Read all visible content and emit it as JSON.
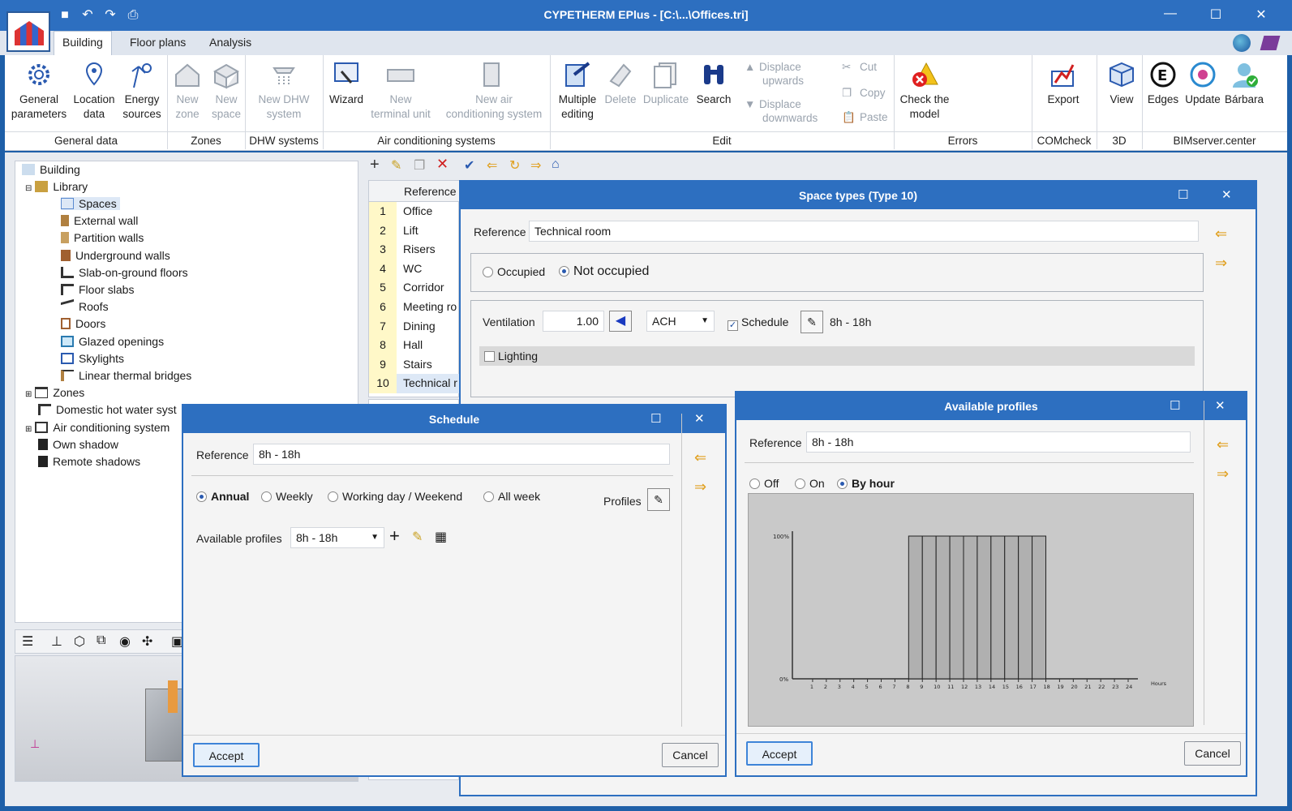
{
  "window": {
    "title": "CYPETHERM EPlus - [C:\\...\\Offices.tri]"
  },
  "tabs": [
    "Building",
    "Floor plans",
    "Analysis"
  ],
  "ribbon": {
    "general_params": [
      "General",
      "parameters"
    ],
    "location": [
      "Location",
      "data"
    ],
    "energy": [
      "Energy",
      "sources"
    ],
    "new_zone": [
      "New",
      "zone"
    ],
    "new_space": [
      "New",
      "space"
    ],
    "new_dhw": [
      "New DHW",
      "system"
    ],
    "wizard": "Wizard",
    "new_terminal": [
      "New",
      "terminal unit"
    ],
    "new_air": [
      "New air",
      "conditioning system"
    ],
    "multi_edit": [
      "Multiple",
      "editing"
    ],
    "delete": "Delete",
    "duplicate": "Duplicate",
    "search": "Search",
    "displace_up": [
      "Displace",
      "upwards"
    ],
    "displace_down": [
      "Displace",
      "downwards"
    ],
    "cut": "Cut",
    "copy": "Copy",
    "paste": "Paste",
    "check": [
      "Check the",
      "model"
    ],
    "export": "Export",
    "view": "View",
    "edges": "Edges",
    "update": "Update",
    "user": "Bárbara",
    "groups": {
      "general": "General data",
      "zones": "Zones",
      "dhw": "DHW systems",
      "air": "Air conditioning systems",
      "edit": "Edit",
      "errors": "Errors",
      "comcheck": "COMcheck",
      "threed": "3D",
      "bim": "BIMserver.center"
    }
  },
  "tree": {
    "building": "Building",
    "library": "Library",
    "items": [
      "Spaces",
      "External wall",
      "Partition walls",
      "Underground walls",
      "Slab-on-ground floors",
      "Floor slabs",
      "Roofs",
      "Doors",
      "Glazed openings",
      "Skylights",
      "Linear thermal bridges"
    ],
    "zones": "Zones",
    "dhw": "Domestic hot water syst",
    "air": "Air conditioning system",
    "own_shadow": "Own shadow",
    "remote": "Remote shadows"
  },
  "table": {
    "header": "Reference",
    "rows": [
      {
        "n": "1",
        "v": "Office"
      },
      {
        "n": "2",
        "v": "Lift"
      },
      {
        "n": "3",
        "v": "Risers"
      },
      {
        "n": "4",
        "v": "WC"
      },
      {
        "n": "5",
        "v": "Corridor"
      },
      {
        "n": "6",
        "v": "Meeting ro"
      },
      {
        "n": "7",
        "v": "Dining"
      },
      {
        "n": "8",
        "v": "Hall"
      },
      {
        "n": "9",
        "v": "Stairs"
      },
      {
        "n": "10",
        "v": "Technical r"
      }
    ]
  },
  "space_types": {
    "title": "Space types (Type 10)",
    "ref_label": "Reference",
    "ref_value": "Technical room",
    "occupied": "Occupied",
    "not_occupied": "Not occupied",
    "ventilation_label": "Ventilation",
    "ventilation_value": "1.00",
    "unit": "ACH",
    "schedule_label": "Schedule",
    "schedule_value": "8h - 18h",
    "lighting": "Lighting"
  },
  "schedule": {
    "title": "Schedule",
    "ref_label": "Reference",
    "ref_value": "8h - 18h",
    "annual": "Annual",
    "weekly": "Weekly",
    "working": "Working day / Weekend",
    "allweek": "All week",
    "profiles": "Profiles",
    "avail_label": "Available profiles",
    "avail_value": "8h - 18h",
    "accept": "Accept",
    "cancel": "Cancel"
  },
  "profiles": {
    "title": "Available profiles",
    "ref_label": "Reference",
    "ref_value": "8h - 18h",
    "off": "Off",
    "on": "On",
    "by_hour": "By hour",
    "accept": "Accept",
    "cancel": "Cancel"
  },
  "chart_data": {
    "type": "bar",
    "categories": [
      "1",
      "2",
      "3",
      "4",
      "5",
      "6",
      "7",
      "8",
      "9",
      "10",
      "11",
      "12",
      "13",
      "14",
      "15",
      "16",
      "17",
      "18",
      "19",
      "20",
      "21",
      "22",
      "23",
      "24"
    ],
    "values": [
      0,
      0,
      0,
      0,
      0,
      0,
      0,
      0,
      100,
      100,
      100,
      100,
      100,
      100,
      100,
      100,
      100,
      100,
      0,
      0,
      0,
      0,
      0,
      0
    ],
    "ymax_label": "100%",
    "ymin_label": "0%",
    "xlabel": "Hours",
    "ylim": [
      0,
      100
    ]
  }
}
